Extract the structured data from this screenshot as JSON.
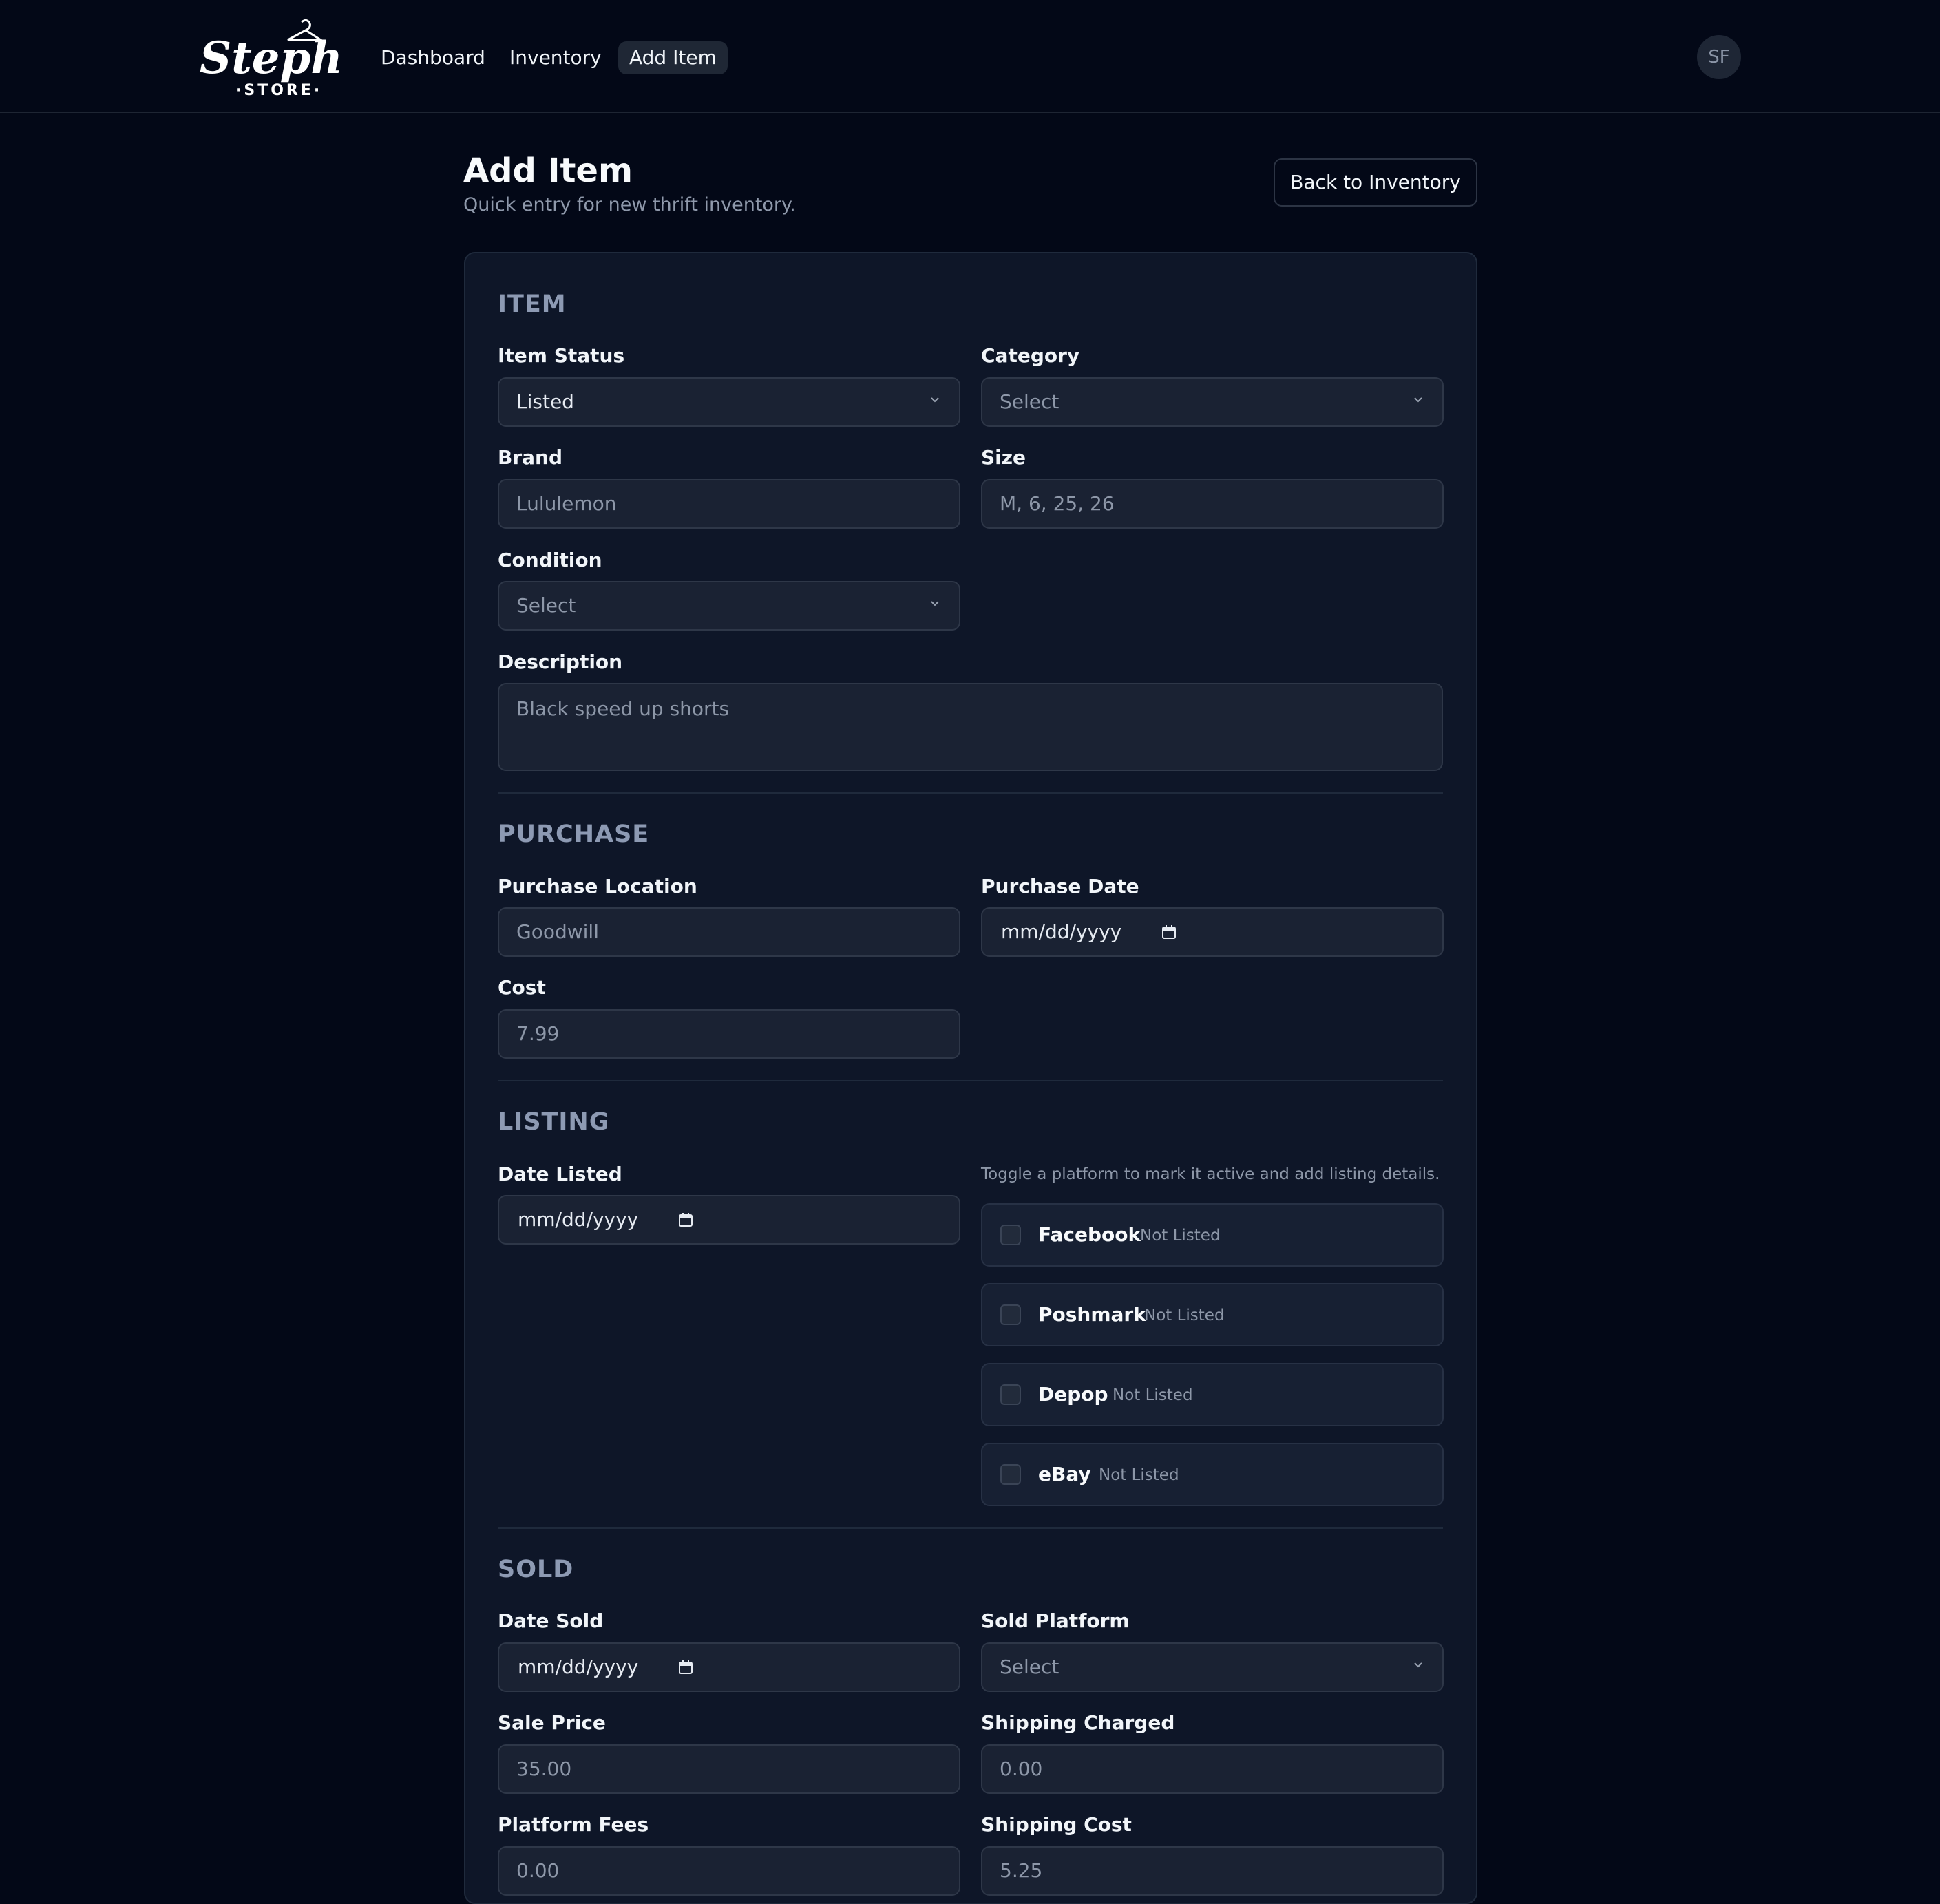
{
  "app": {
    "logo_text": "Steph's STORE",
    "avatar_initials": "SF"
  },
  "nav": {
    "items": [
      {
        "label": "Dashboard"
      },
      {
        "label": "Inventory"
      },
      {
        "label": "Add Item",
        "active": true
      }
    ]
  },
  "header": {
    "title": "Add Item",
    "subtitle": "Quick entry for new thrift inventory.",
    "back_button": "Back to Inventory"
  },
  "sections": {
    "item": {
      "title": "ITEM",
      "status_label": "Item Status",
      "status_value": "Listed",
      "category_label": "Category",
      "category_value": "Select",
      "brand_label": "Brand",
      "brand_placeholder": "Lululemon",
      "size_label": "Size",
      "size_placeholder": "M, 6, 25, 26",
      "condition_label": "Condition",
      "condition_value": "Select",
      "description_label": "Description",
      "description_placeholder": "Black speed up shorts"
    },
    "purchase": {
      "title": "PURCHASE",
      "location_label": "Purchase Location",
      "location_placeholder": "Goodwill",
      "date_label": "Purchase Date",
      "date_value": "mm/dd/yyyy",
      "cost_label": "Cost",
      "cost_placeholder": "7.99"
    },
    "listing": {
      "title": "LISTING",
      "date_label": "Date Listed",
      "date_value": "mm/dd/yyyy",
      "hint": "Toggle a platform to mark it active and add listing details.",
      "platforms": [
        {
          "name": "Facebook",
          "status": "Not Listed",
          "checked": false
        },
        {
          "name": "Poshmark",
          "status": "Not Listed",
          "checked": false
        },
        {
          "name": "Depop",
          "status": "Not Listed",
          "checked": false
        },
        {
          "name": "eBay",
          "status": "Not Listed",
          "checked": false
        }
      ]
    },
    "sold": {
      "title": "SOLD",
      "date_label": "Date Sold",
      "date_value": "mm/dd/yyyy",
      "platform_label": "Sold Platform",
      "platform_value": "Select",
      "sale_price_label": "Sale Price",
      "sale_price_placeholder": "35.00",
      "shipping_charged_label": "Shipping Charged",
      "shipping_charged_placeholder": "0.00",
      "platform_fees_label": "Platform Fees",
      "platform_fees_placeholder": "0.00",
      "shipping_cost_label": "Shipping Cost",
      "shipping_cost_placeholder": "5.25"
    }
  },
  "colors": {
    "background": "#030817",
    "card": "#0e1628",
    "input": "#1a2233",
    "section_title": "#8d9ab3",
    "muted_text": "#8d97a8"
  }
}
